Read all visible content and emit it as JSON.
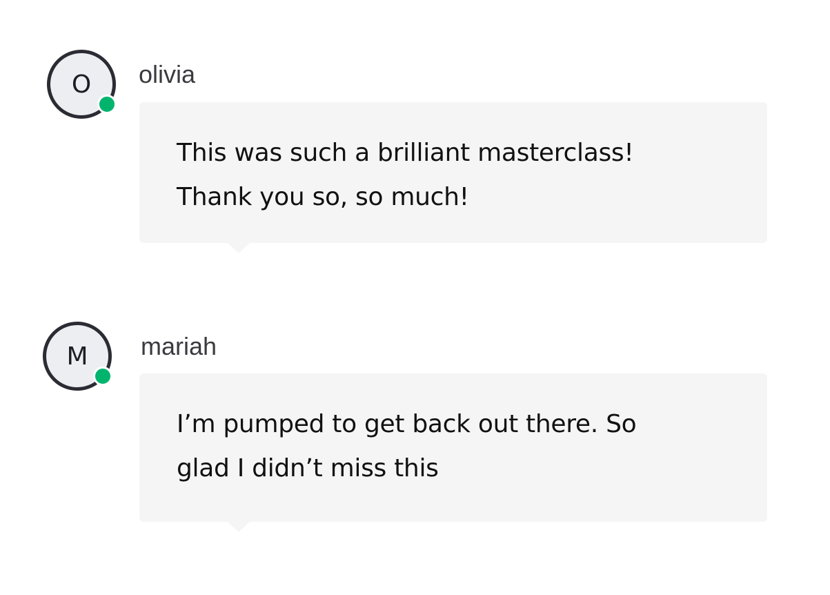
{
  "messages": [
    {
      "username": "olivia",
      "avatar_initial": "O",
      "online": true,
      "lines": [
        "This was such a brilliant masterclass!",
        "Thank you so, so much!"
      ]
    },
    {
      "username": "mariah",
      "avatar_initial": "M",
      "online": true,
      "lines": [
        "I’m pumped to get back out there. So",
        "glad I didn’t miss this"
      ]
    }
  ],
  "colors": {
    "presence": "#00b46e",
    "bubble": "#f5f5f5",
    "avatar_border": "#2b2b33",
    "avatar_fill": "#eceef2"
  }
}
